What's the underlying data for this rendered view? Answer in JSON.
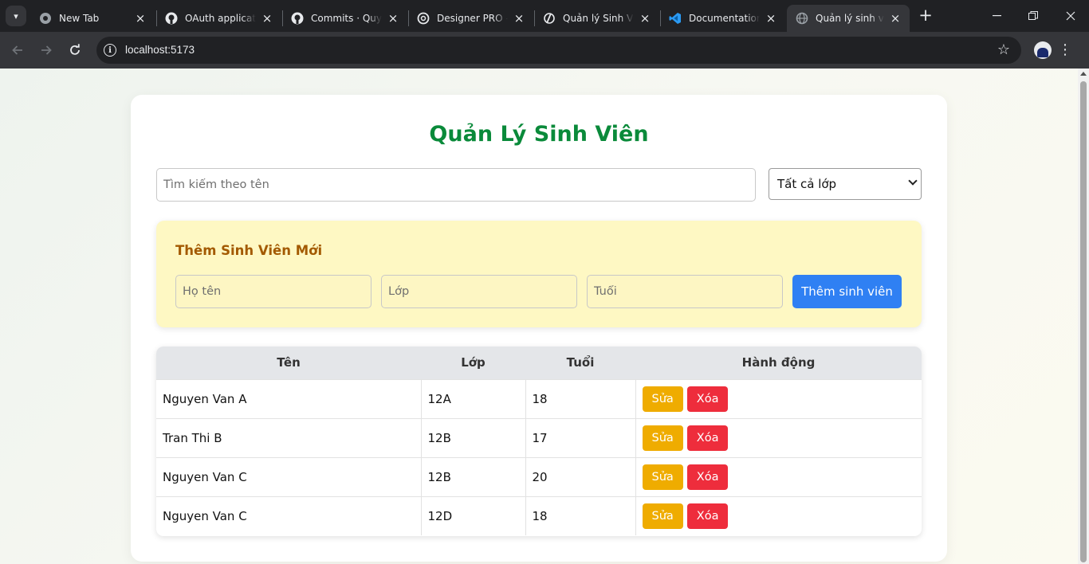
{
  "tabs": [
    {
      "title": "New Tab",
      "icon": "chrome-icon"
    },
    {
      "title": "OAuth applications",
      "icon": "github-icon"
    },
    {
      "title": "Commits · Quynh",
      "icon": "github-icon"
    },
    {
      "title": "Designer PRO — ",
      "icon": "openai-icon"
    },
    {
      "title": "Quản lý Sinh Viên",
      "icon": "vite-icon"
    },
    {
      "title": "Documentation",
      "icon": "vscode-icon"
    },
    {
      "title": "Quản lý sinh viên",
      "icon": "globe-icon",
      "active": true
    }
  ],
  "toolbar": {
    "url": "localhost:5173"
  },
  "app": {
    "title": "Quản Lý Sinh Viên",
    "search": {
      "placeholder": "Tìm kiếm theo tên",
      "value": ""
    },
    "class_filter": {
      "selected": "Tất cả lớp"
    },
    "add_form": {
      "title": "Thêm Sinh Viên Mới",
      "name_placeholder": "Họ tên",
      "class_placeholder": "Lớp",
      "age_placeholder": "Tuổi",
      "submit_label": "Thêm sinh viên"
    },
    "table": {
      "headers": [
        "Tên",
        "Lớp",
        "Tuổi",
        "Hành động"
      ],
      "rows": [
        {
          "name": "Nguyen Van A",
          "class": "12A",
          "age": "18"
        },
        {
          "name": "Tran Thi B",
          "class": "12B",
          "age": "17"
        },
        {
          "name": "Nguyen Van C",
          "class": "12B",
          "age": "20"
        },
        {
          "name": "Nguyen Van C",
          "class": "12D",
          "age": "18"
        }
      ],
      "edit_label": "Sửa",
      "delete_label": "Xóa"
    }
  },
  "colors": {
    "heading": "#0a8a3a",
    "panel_bg": "#fef8c3",
    "panel_title": "#a35a00",
    "primary": "#2f80f3",
    "edit": "#efac00",
    "delete": "#ee2d3c"
  }
}
